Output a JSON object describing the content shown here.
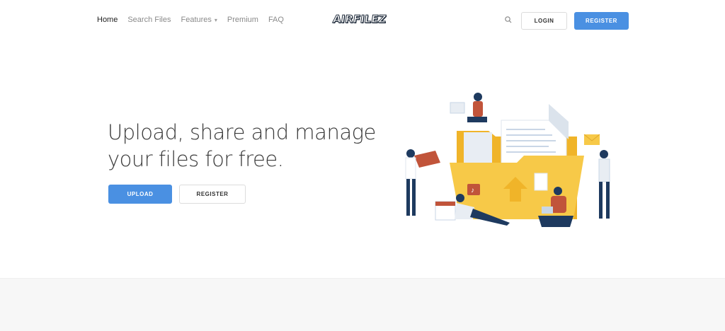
{
  "header": {
    "nav": [
      "Home",
      "Search Files",
      "Features",
      "Premium",
      "FAQ"
    ],
    "logo_text": "AIRFILEZ",
    "login_label": "LOGIN",
    "register_label": "REGISTER"
  },
  "hero": {
    "title_line1": "Upload, share and manage",
    "title_line2": "your files for free.",
    "upload_label": "UPLOAD",
    "register_label": "REGISTER"
  },
  "colors": {
    "accent": "#4a90e2",
    "folder": "#f7c948",
    "person_dark": "#1e3a5f",
    "person_red": "#c1543a"
  }
}
